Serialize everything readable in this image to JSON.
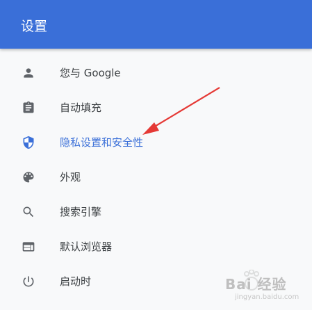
{
  "header": {
    "title": "设置",
    "color": "#3a6fd8"
  },
  "menu": {
    "items": [
      {
        "label": "您与 Google",
        "icon": "person-icon"
      },
      {
        "label": "自动填充",
        "icon": "clipboard-icon"
      },
      {
        "label": "隐私设置和安全性",
        "icon": "shield-icon",
        "active": true
      },
      {
        "label": "外观",
        "icon": "palette-icon"
      },
      {
        "label": "搜索引擎",
        "icon": "search-icon"
      },
      {
        "label": "默认浏览器",
        "icon": "browser-window-icon"
      },
      {
        "label": "启动时",
        "icon": "power-icon"
      }
    ]
  },
  "annotation": {
    "arrow_color": "#e53935"
  },
  "watermark": {
    "text": "Bai 经验",
    "sub": "jingyan.baidu.com"
  }
}
